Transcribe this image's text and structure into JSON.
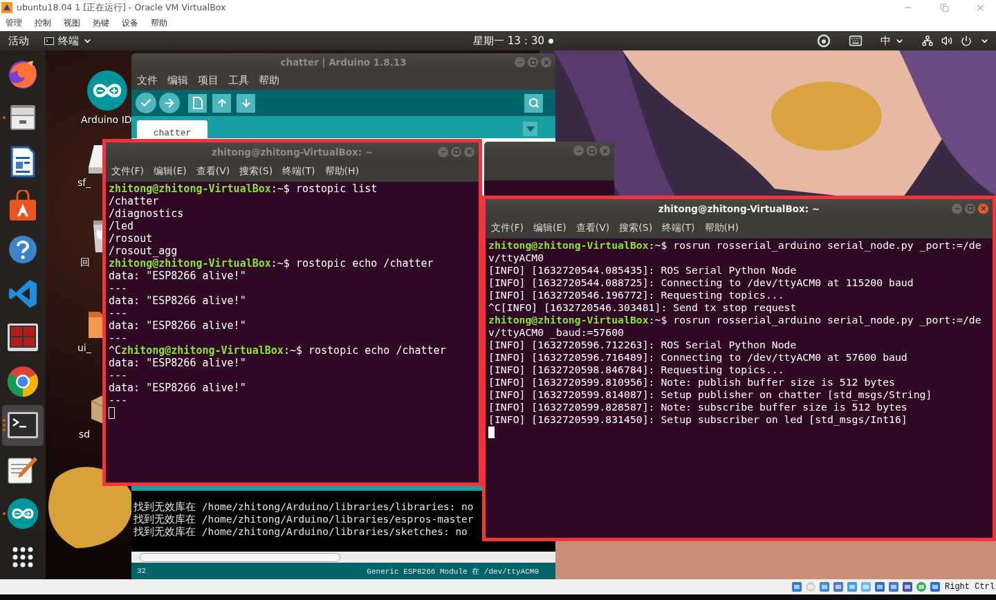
{
  "vbox": {
    "title": "ubuntu18.04 1 [正在运行] - Oracle VM VirtualBox",
    "menu": [
      "管理",
      "控制",
      "视图",
      "热键",
      "设备",
      "帮助"
    ]
  },
  "topbar": {
    "activities": "活动",
    "app": "终端",
    "clock": "星期一 13：30",
    "input_method": "中"
  },
  "dock": [
    {
      "kind": "fox",
      "running": false,
      "multiple_windows": false,
      "selected": false
    },
    {
      "kind": "cabinet",
      "running": true,
      "multiple_windows": false,
      "selected": false
    },
    {
      "kind": "writer",
      "running": false,
      "multiple_windows": false,
      "selected": false
    },
    {
      "kind": "store",
      "running": false,
      "multiple_windows": false,
      "selected": false
    },
    {
      "kind": "help",
      "running": false,
      "multiple_windows": false,
      "selected": false
    },
    {
      "kind": "code",
      "running": false,
      "multiple_windows": false,
      "selected": false
    },
    {
      "kind": "tiles",
      "running": false,
      "multiple_windows": false,
      "selected": false
    },
    {
      "kind": "chrome",
      "running": false,
      "multiple_windows": false,
      "selected": false
    },
    {
      "kind": "terminal",
      "running": true,
      "multiple_windows": true,
      "selected": true
    },
    {
      "kind": "notepad",
      "running": false,
      "multiple_windows": false,
      "selected": false
    },
    {
      "kind": "arduino",
      "running": true,
      "multiple_windows": false,
      "selected": false
    },
    {
      "kind": "grid",
      "running": false,
      "multiple_windows": false,
      "selected": false
    }
  ],
  "desktop_icons": [
    {
      "kind": "arduino",
      "label": "Arduino ID"
    },
    {
      "kind": "drive",
      "label": "sf_"
    },
    {
      "kind": "trash",
      "label": "回"
    },
    {
      "kind": "folder",
      "label": "ui_"
    },
    {
      "kind": "package",
      "label": "sd"
    }
  ],
  "arduino": {
    "title": "chatter | Arduino 1.8.13",
    "menu": [
      "文件",
      "编辑",
      "项目",
      "工具",
      "帮助"
    ],
    "tabs": [
      {
        "label": "chatter",
        "selected": true
      }
    ],
    "console": [
      "找到无效库在 /home/zhitong/Arduino/libraries/libraries: no",
      "找到无效库在 /home/zhitong/Arduino/libraries/espros-master",
      "找到无效库在 /home/zhitong/Arduino/libraries/sketches: no"
    ],
    "line_number": "32",
    "board": "Generic ESP8266 Module 在 /dev/ttyACM0"
  },
  "terminal_left": {
    "title": "zhitong@zhitong-VirtualBox: ~",
    "active": false,
    "menu": [
      "文件(F)",
      "编辑(E)",
      "查看(V)",
      "搜索(S)",
      "终端(T)",
      "帮助(H)"
    ],
    "lines": [
      {
        "prompt": "zhitong@zhitong-VirtualBox",
        "text": ":~$ rostopic list"
      },
      {
        "text": "/chatter"
      },
      {
        "text": "/diagnostics"
      },
      {
        "text": "/led"
      },
      {
        "text": "/rosout"
      },
      {
        "text": "/rosout_agg"
      },
      {
        "prompt": "zhitong@zhitong-VirtualBox",
        "text": ":~$ rostopic echo /chatter"
      },
      {
        "text": "data: \"ESP8266 alive!\""
      },
      {
        "text": "---"
      },
      {
        "text": "data: \"ESP8266 alive!\""
      },
      {
        "text": "---"
      },
      {
        "text": "data: \"ESP8266 alive!\""
      },
      {
        "text": "---"
      },
      {
        "prefix": "^C",
        "prompt": "zhitong@zhitong-VirtualBox",
        "text": ":~$ rostopic echo /chatter"
      },
      {
        "text": "data: \"ESP8266 alive!\""
      },
      {
        "text": "---"
      },
      {
        "text": "data: \"ESP8266 alive!\""
      },
      {
        "text": "---"
      }
    ]
  },
  "terminal_right": {
    "title": "zhitong@zhitong-VirtualBox: ~",
    "active": true,
    "menu": [
      "文件(F)",
      "编辑(E)",
      "查看(V)",
      "搜索(S)",
      "终端(T)",
      "帮助(H)"
    ],
    "lines": [
      {
        "prompt": "zhitong@zhitong-VirtualBox",
        "text": ":~$ rosrun rosserial_arduino serial_node.py _port:=/de"
      },
      {
        "text": "v/ttyACM0"
      },
      {
        "text": "[INFO] [1632720544.085435]: ROS Serial Python Node"
      },
      {
        "text": "[INFO] [1632720544.088725]: Connecting to /dev/ttyACM0 at 115200 baud"
      },
      {
        "text": "[INFO] [1632720546.196772]: Requesting topics..."
      },
      {
        "text": "^C[INFO] [1632720546.303481]: Send tx stop request"
      },
      {
        "prompt": "zhitong@zhitong-VirtualBox",
        "text": ":~$ rosrun rosserial_arduino serial_node.py _port:=/de"
      },
      {
        "text": "v/ttyACM0 _baud:=57600"
      },
      {
        "text": "[INFO] [1632720596.712263]: ROS Serial Python Node"
      },
      {
        "text": "[INFO] [1632720596.716489]: Connecting to /dev/ttyACM0 at 57600 baud"
      },
      {
        "text": "[INFO] [1632720598.846784]: Requesting topics..."
      },
      {
        "text": "[INFO] [1632720599.810956]: Note: publish buffer size is 512 bytes"
      },
      {
        "text": "[INFO] [1632720599.814087]: Setup publisher on chatter [std_msgs/String]"
      },
      {
        "text": "[INFO] [1632720599.828587]: Note: subscribe buffer size is 512 bytes"
      },
      {
        "text": "[INFO] [1632720599.831450]: Setup subscriber on led [std_msgs/Int16]"
      }
    ]
  },
  "statusbar": {
    "host_key": "Right Ctrl"
  }
}
